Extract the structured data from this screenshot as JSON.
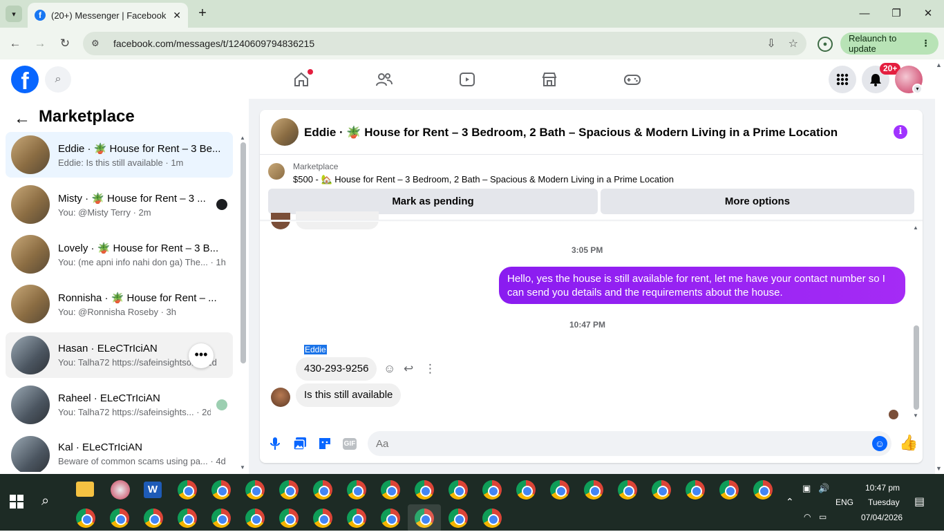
{
  "browser": {
    "tab_title": "(20+) Messenger | Facebook",
    "url": "facebook.com/messages/t/1240609794836215",
    "relaunch_label": "Relaunch to update"
  },
  "fb": {
    "notification_badge": "20+",
    "accent_color": "#0866ff"
  },
  "sidebar": {
    "title": "Marketplace",
    "conversations": [
      {
        "name": "Eddie · 🪴 House for Rent – 3 Be...",
        "preview": "Eddie: Is this still available",
        "time": "1m"
      },
      {
        "name": "Misty · 🪴 House for Rent – 3 ...",
        "preview": "You: @Misty Terry",
        "time": "2m"
      },
      {
        "name": "Lovely · 🪴 House for Rent – 3 B...",
        "preview": "You: (me apni info nahi don ga) The...",
        "time": "1h"
      },
      {
        "name": "Ronnisha · 🪴 House for Rent – ...",
        "preview": "You: @Ronnisha Roseby",
        "time": "3h"
      },
      {
        "name": "Hasan · ELeCTrIciAN",
        "preview": "You: Talha72 https://safeinsightso...",
        "time": "1d"
      },
      {
        "name": "Raheel · ELeCTrIciAN",
        "preview": "You: Talha72 https://safeinsights...",
        "time": "2d"
      },
      {
        "name": "Kal · ELeCTrIciAN",
        "preview": "Beware of common scams using pa...",
        "time": "4d"
      }
    ]
  },
  "chat": {
    "title": "Eddie · 🪴 House for Rent – 3 Bedroom, 2 Bath – Spacious & Modern Living in a Prime Location",
    "listing_label": "Marketplace",
    "listing_desc": "$500 - 🏡 House for Rent – 3 Bedroom, 2 Bath – Spacious & Modern Living in a Prime Location",
    "mark_pending": "Mark as pending",
    "more_options": "More options",
    "timestamp_1": "3:05 PM",
    "outgoing_message": "Hello, yes the house is still available for rent, let me have your contact number so I can send you details and the requirements about the house.",
    "timestamp_2": "10:47 PM",
    "sender_name": "Eddie",
    "incoming_1": "430-293-9256",
    "incoming_2": "Is this still available",
    "composer_placeholder": "Aa",
    "gif_label": "GIF"
  },
  "taskbar": {
    "language": "ENG",
    "time": "10:47 pm",
    "day": "Tuesday",
    "date": "07/04/2026"
  }
}
